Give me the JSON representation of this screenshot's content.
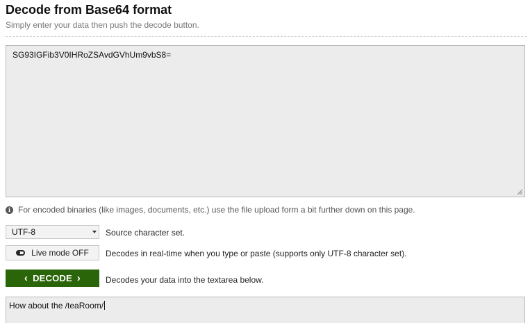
{
  "header": {
    "title": "Decode from Base64 format",
    "subtitle": "Simply enter your data then push the decode button."
  },
  "input": {
    "value": "SG93IGFib3V0IHRoZSAvdGVhUm9vbS8="
  },
  "info": {
    "icon": "info-icon",
    "text": "For encoded binaries (like images, documents, etc.) use the file upload form a bit further down on this page."
  },
  "charset": {
    "selected": "UTF-8",
    "label": "Source character set."
  },
  "live_mode": {
    "button_label": "Live mode OFF",
    "description": "Decodes in real-time when you type or paste (supports only UTF-8 character set)."
  },
  "decode": {
    "button_label": "DECODE",
    "description": "Decodes your data into the textarea below.",
    "accent_color": "#2a650a"
  },
  "output": {
    "value": "How about the /teaRoom/"
  }
}
